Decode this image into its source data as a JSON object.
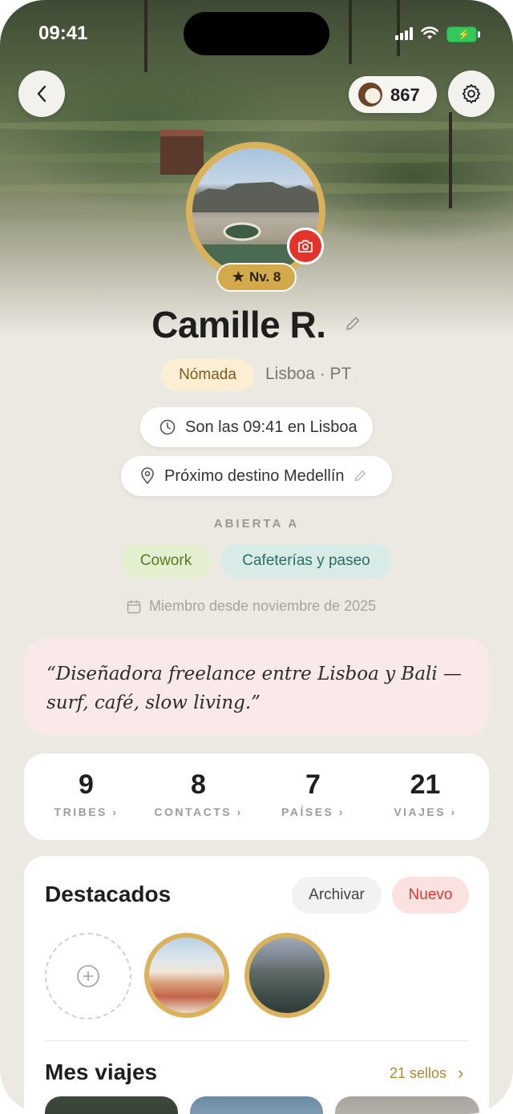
{
  "status_bar": {
    "time": "09:41"
  },
  "header": {
    "coins": "867"
  },
  "profile": {
    "level": "Nv. 8",
    "name": "Camille R.",
    "type_chip": "Nómada",
    "location": "Lisboa · PT",
    "local_time": "Son las 09:41 en Lisboa",
    "next_destination": "Próximo destino Medellín",
    "open_to_label": "ABIERTA A",
    "open_to": [
      "Cowork",
      "Cafeterías y paseo"
    ],
    "member_since": "Miembro desde noviembre de 2025",
    "bio": "“Diseñadora freelance entre Lisboa y Bali — surf, café, slow living.”"
  },
  "stats": [
    {
      "value": "9",
      "label": "TRIBES"
    },
    {
      "value": "8",
      "label": "CONTACTS"
    },
    {
      "value": "7",
      "label": "PAÍSES"
    },
    {
      "value": "21",
      "label": "VIAJES"
    }
  ],
  "highlights": {
    "title": "Destacados",
    "archive_label": "Archivar",
    "new_label": "Nuevo"
  },
  "trips": {
    "title": "Mes viajes",
    "count_label": "21 sellos"
  },
  "colors": {
    "accent_red": "#e2342b",
    "gold": "#d3a94b",
    "background": "#ece8e2"
  }
}
